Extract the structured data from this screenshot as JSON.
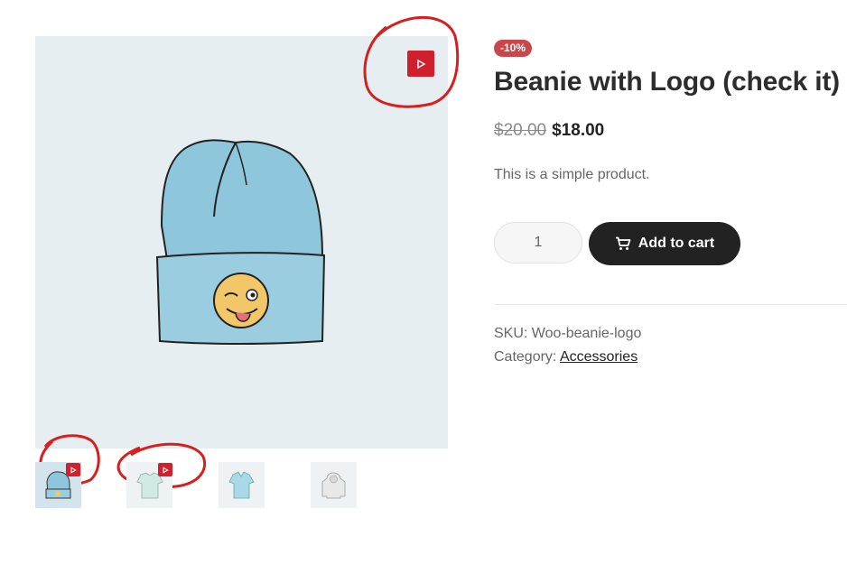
{
  "product": {
    "sale_badge": "-10%",
    "title": "Beanie with Logo (check it)",
    "price_old": "$20.00",
    "price_new": "$18.00",
    "short_description": "This is a simple product.",
    "quantity": "1",
    "add_to_cart_label": "Add to cart",
    "sku_label": "SKU:",
    "sku_value": "Woo-beanie-logo",
    "category_label": "Category:",
    "category_value": "Accessories"
  },
  "gallery": {
    "main_image": "beanie-with-logo",
    "thumbnails": [
      {
        "image": "beanie",
        "has_video": true
      },
      {
        "image": "t-shirt",
        "has_video": true
      },
      {
        "image": "polo",
        "has_video": false
      },
      {
        "image": "hoodie",
        "has_video": false
      }
    ]
  },
  "colors": {
    "video_button": "#d0202e",
    "sale_badge": "#c9464b",
    "annotation": "#d61f1f",
    "cart_button": "#222222"
  },
  "icons": {
    "video": "play-icon",
    "cart": "cart-icon"
  }
}
